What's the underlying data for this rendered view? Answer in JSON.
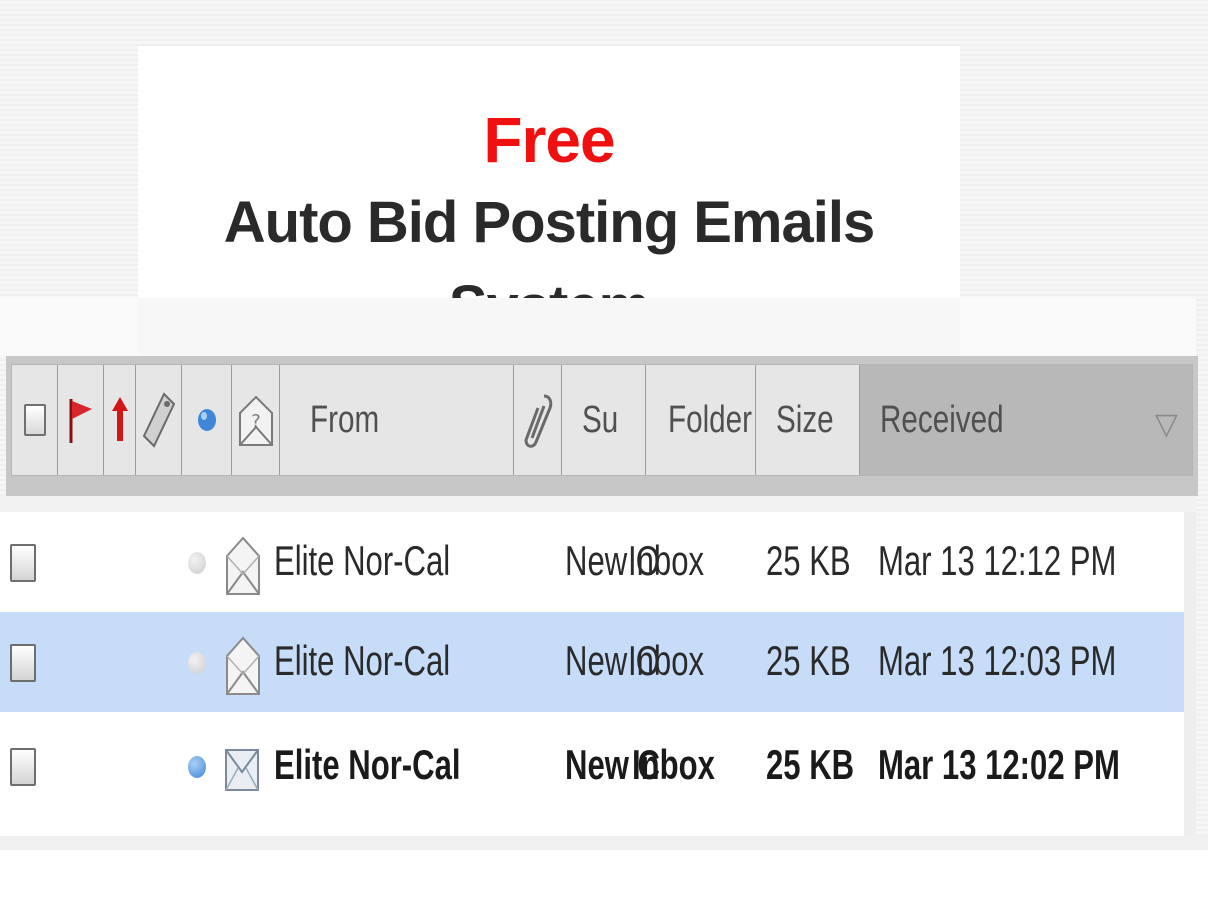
{
  "banner": {
    "line1": "Free",
    "line2": "Auto Bid Posting Emails",
    "line3": "System",
    "line1_color": "#f01010",
    "text_color": "#2a2a2a"
  },
  "header": {
    "columns": [
      {
        "name": "attachment-type-icon",
        "label": ""
      },
      {
        "name": "flag-icon",
        "label": ""
      },
      {
        "name": "importance-icon",
        "label": ""
      },
      {
        "name": "tag-icon",
        "label": ""
      },
      {
        "name": "status-dot-icon",
        "label": ""
      },
      {
        "name": "read-status-icon",
        "label": ""
      },
      {
        "name": "from",
        "label": "From"
      },
      {
        "name": "attachment-icon",
        "label": ""
      },
      {
        "name": "subject",
        "label": "Su"
      },
      {
        "name": "folder",
        "label": "Folder"
      },
      {
        "name": "size",
        "label": "Size"
      },
      {
        "name": "received",
        "label": "Received"
      }
    ],
    "sort_column": "Received",
    "sort_icon": "sort-descending-icon"
  },
  "messages": [
    {
      "from": "Elite Nor-Cal",
      "subject": "New O",
      "folder": "Inbox",
      "size": "25 KB",
      "received": "Mar 13 12:12 PM",
      "unread": false,
      "selected": false
    },
    {
      "from": "Elite Nor-Cal",
      "subject": "New O",
      "folder": "Inbox",
      "size": "25 KB",
      "received": "Mar 13 12:03 PM",
      "unread": false,
      "selected": true
    },
    {
      "from": "Elite Nor-Cal",
      "subject": "New C",
      "folder": "Inbox",
      "size": "25 KB",
      "received": "Mar 13 12:02 PM",
      "unread": true,
      "selected": false
    }
  ],
  "colors": {
    "selected_row": "#c6dcf8",
    "header_bg": "#e6e6e6",
    "received_header_bg": "#b8b8b8",
    "unread_dot": "#3f86d6",
    "flag": "#d8262c"
  }
}
